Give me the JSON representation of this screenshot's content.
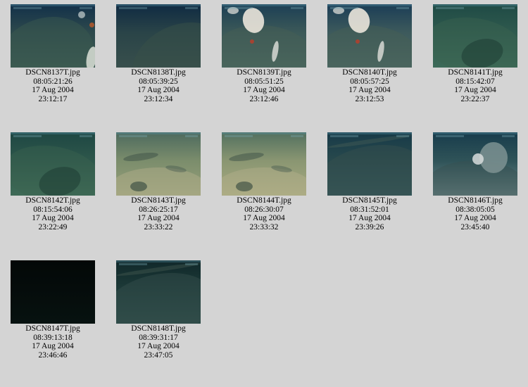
{
  "gallery": {
    "items": [
      {
        "file": "DSCN8137T.jpg",
        "timecode": "08:05:21:26",
        "date": "17 Aug 2004",
        "time": "23:12:17",
        "scene": "dark-rock-coral",
        "colors": [
          "#12304a",
          "#2e4a4c",
          "#3c5a52"
        ]
      },
      {
        "file": "DSCN8138T.jpg",
        "timecode": "08:05:39:25",
        "date": "17 Aug 2004",
        "time": "23:12:34",
        "scene": "dark-rock",
        "colors": [
          "#0f2a42",
          "#2a4448",
          "#384f4c"
        ]
      },
      {
        "file": "DSCN8139T.jpg",
        "timecode": "08:05:51:25",
        "date": "17 Aug 2004",
        "time": "23:12:46",
        "scene": "rock-white-coral",
        "colors": [
          "#1c3f55",
          "#3c5958",
          "#4b6a63"
        ]
      },
      {
        "file": "DSCN8140T.jpg",
        "timecode": "08:05:57:25",
        "date": "17 Aug 2004",
        "time": "23:12:53",
        "scene": "rock-white-coral",
        "colors": [
          "#1b3d56",
          "#3d5a5c",
          "#4d6a66"
        ]
      },
      {
        "file": "DSCN8141T.jpg",
        "timecode": "08:15:42:07",
        "date": "17 Aug 2004",
        "time": "23:22:37",
        "scene": "green-rock",
        "colors": [
          "#1f4a45",
          "#2f5a4e",
          "#3c6a58"
        ]
      },
      {
        "file": "DSCN8142T.jpg",
        "timecode": "08:15:54:06",
        "date": "17 Aug 2004",
        "time": "23:22:49",
        "scene": "green-rock",
        "colors": [
          "#1e4743",
          "#2e574b",
          "#3f6b57"
        ]
      },
      {
        "file": "DSCN8143T.jpg",
        "timecode": "08:26:25:17",
        "date": "17 Aug 2004",
        "time": "23:33:22",
        "scene": "sandy-floor",
        "colors": [
          "#4d6a5e",
          "#7b8d6c",
          "#98a07a"
        ]
      },
      {
        "file": "DSCN8144T.jpg",
        "timecode": "08:26:30:07",
        "date": "17 Aug 2004",
        "time": "23:33:32",
        "scene": "sandy-floor",
        "colors": [
          "#52705f",
          "#8a9672",
          "#a8aa80"
        ]
      },
      {
        "file": "DSCN8145T.jpg",
        "timecode": "08:31:52:01",
        "date": "17 Aug 2004",
        "time": "23:39:26",
        "scene": "dark-ledge",
        "colors": [
          "#173a48",
          "#28494d",
          "#35575a"
        ]
      },
      {
        "file": "DSCN8146T.jpg",
        "timecode": "08:38:05:05",
        "date": "17 Aug 2004",
        "time": "23:45:40",
        "scene": "rock-boulder",
        "colors": [
          "#183c4c",
          "#2f5358",
          "#6f8888"
        ]
      },
      {
        "file": "DSCN8147T.jpg",
        "timecode": "08:39:13:18",
        "date": "17 Aug 2004",
        "time": "23:46:46",
        "scene": "black",
        "colors": [
          "#030807",
          "#050c0b",
          "#071210"
        ]
      },
      {
        "file": "DSCN8148T.jpg",
        "timecode": "08:39:31:17",
        "date": "17 Aug 2004",
        "time": "23:47:05",
        "scene": "dark-ledge",
        "colors": [
          "#10282a",
          "#1d3a38",
          "#2b4a46"
        ]
      }
    ]
  }
}
